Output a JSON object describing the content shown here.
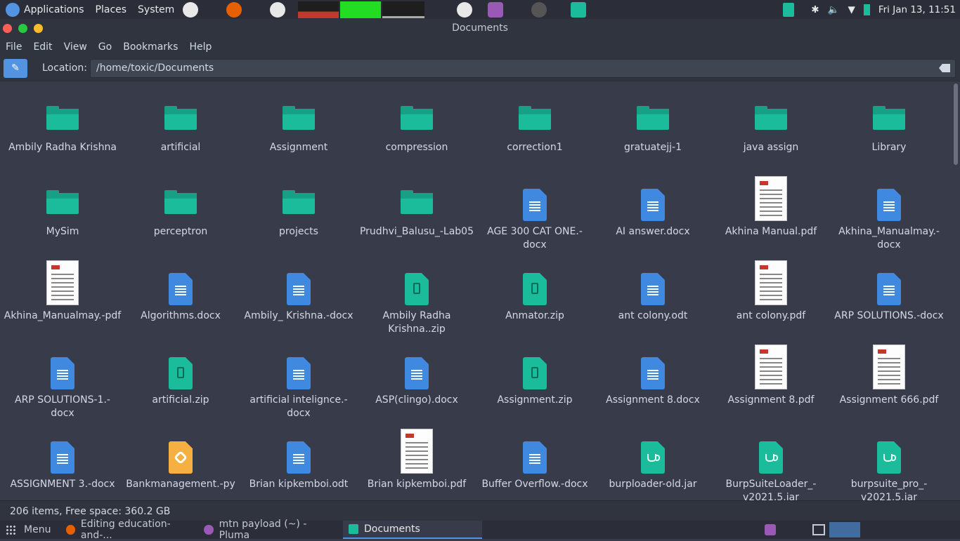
{
  "top_panel": {
    "menus": [
      "Applications",
      "Places",
      "System"
    ],
    "clock": "Fri Jan 13, 11:51"
  },
  "window": {
    "title": "Documents"
  },
  "menubar": [
    "File",
    "Edit",
    "View",
    "Go",
    "Bookmarks",
    "Help"
  ],
  "location": {
    "label": "Location:",
    "value": "/home/toxic/Documents"
  },
  "files": [
    {
      "name": "Ambily Radha Krishna",
      "kind": "folder"
    },
    {
      "name": "artificial",
      "kind": "folder"
    },
    {
      "name": "Assignment",
      "kind": "folder"
    },
    {
      "name": "compression",
      "kind": "folder"
    },
    {
      "name": "correction1",
      "kind": "folder"
    },
    {
      "name": "gratuatejj-1",
      "kind": "folder"
    },
    {
      "name": "java assign",
      "kind": "folder"
    },
    {
      "name": "Library",
      "kind": "folder"
    },
    {
      "name": "MySim",
      "kind": "folder"
    },
    {
      "name": "perceptron",
      "kind": "folder"
    },
    {
      "name": "projects",
      "kind": "folder"
    },
    {
      "name": "Prudhvi_Balusu_-Lab05",
      "kind": "folder"
    },
    {
      "name": "AGE 300 CAT ONE.-docx",
      "kind": "doc"
    },
    {
      "name": "AI answer.docx",
      "kind": "doc"
    },
    {
      "name": "Akhina Manual.pdf",
      "kind": "pdf"
    },
    {
      "name": "Akhina_Manualmay.-docx",
      "kind": "doc"
    },
    {
      "name": "Akhina_Manualmay.-pdf",
      "kind": "pdf"
    },
    {
      "name": "Algorithms.docx",
      "kind": "doc"
    },
    {
      "name": "Ambily_ Krishna.-docx",
      "kind": "doc"
    },
    {
      "name": "Ambily Radha Krishna..zip",
      "kind": "zip"
    },
    {
      "name": "Anmator.zip",
      "kind": "zip"
    },
    {
      "name": "ant colony.odt",
      "kind": "doc"
    },
    {
      "name": "ant colony.pdf",
      "kind": "pdf"
    },
    {
      "name": "ARP SOLUTIONS.-docx",
      "kind": "doc"
    },
    {
      "name": "ARP SOLUTIONS-1.-docx",
      "kind": "doc"
    },
    {
      "name": "artificial.zip",
      "kind": "zip"
    },
    {
      "name": "artificial intelignce.-docx",
      "kind": "doc"
    },
    {
      "name": "ASP(clingo).docx",
      "kind": "doc"
    },
    {
      "name": "Assignment.zip",
      "kind": "zip"
    },
    {
      "name": "Assignment 8.docx",
      "kind": "doc"
    },
    {
      "name": "Assignment 8.pdf",
      "kind": "pdf"
    },
    {
      "name": "Assignment 666.pdf",
      "kind": "pdf"
    },
    {
      "name": "ASSIGNMENT 3.-docx",
      "kind": "doc"
    },
    {
      "name": "Bankmanagement.-py",
      "kind": "py"
    },
    {
      "name": "Brian kipkemboi.odt",
      "kind": "doc"
    },
    {
      "name": "Brian kipkemboi.pdf",
      "kind": "pdf"
    },
    {
      "name": "Buffer Overflow.-docx",
      "kind": "doc"
    },
    {
      "name": "burploader-old.jar",
      "kind": "jar"
    },
    {
      "name": "BurpSuiteLoader_-v2021.5.jar",
      "kind": "jar"
    },
    {
      "name": "burpsuite_pro_-v2021.5.jar",
      "kind": "jar"
    }
  ],
  "status": "206 items, Free space: 360.2 GB",
  "taskbar": {
    "menu": "Menu",
    "tasks": [
      "Editing education-and-...",
      "mtn payload (~) - Pluma",
      "Documents"
    ]
  }
}
